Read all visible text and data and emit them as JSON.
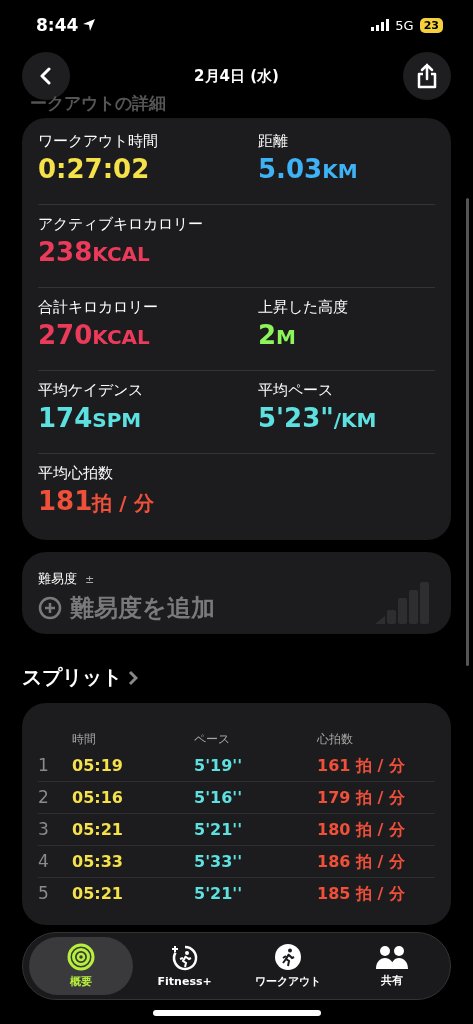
{
  "status_bar": {
    "time": "8:44",
    "network": "5G",
    "battery": "23"
  },
  "header": {
    "title": "2月4日 (水)",
    "behind_heading": "ークアウトの詳細"
  },
  "metrics": [
    {
      "cells": [
        {
          "label": "ワークアウト時間",
          "value": "0:27:02",
          "color": "#f5e14a"
        },
        {
          "label": "距離",
          "value": "5.03",
          "unit": "KM",
          "color": "#3fb1f5"
        }
      ]
    },
    {
      "cells": [
        {
          "label": "アクティブキロカロリー",
          "value": "238",
          "unit": "KCAL",
          "color": "#ec3a5a"
        }
      ]
    },
    {
      "cells": [
        {
          "label": "合計キロカロリー",
          "value": "270",
          "unit": "KCAL",
          "color": "#ec3a5a"
        },
        {
          "label": "上昇した高度",
          "value": "2",
          "unit": "M",
          "color": "#8df55a"
        }
      ]
    },
    {
      "cells": [
        {
          "label": "平均ケイデンス",
          "value": "174",
          "unit": "SPM",
          "color": "#5ce0e0"
        },
        {
          "label": "平均ペース",
          "value": "5'23\"",
          "unit": "/KM",
          "color": "#5ce0e0"
        }
      ]
    },
    {
      "cells": [
        {
          "label": "平均心拍数",
          "value": "181",
          "unit": "拍 / 分",
          "color": "#f0503a"
        }
      ]
    }
  ],
  "difficulty": {
    "label": "難易度",
    "symbol": "±",
    "action": "難易度を追加"
  },
  "splits": {
    "title": "スプリット",
    "columns": [
      "時間",
      "ペース",
      "心拍数"
    ],
    "rows": [
      {
        "index": "1",
        "time": "05:19",
        "pace": "5'19''",
        "heart": "161 拍 / 分"
      },
      {
        "index": "2",
        "time": "05:16",
        "pace": "5'16''",
        "heart": "179 拍 / 分"
      },
      {
        "index": "3",
        "time": "05:21",
        "pace": "5'21''",
        "heart": "180 拍 / 分"
      },
      {
        "index": "4",
        "time": "05:33",
        "pace": "5'33''",
        "heart": "186 拍 / 分"
      },
      {
        "index": "5",
        "time": "05:21",
        "pace": "5'21''",
        "heart": "185 拍 / 分"
      }
    ]
  },
  "tabs": [
    {
      "label": "概要",
      "kind": "rings",
      "selected": true
    },
    {
      "label": "Fitness+",
      "kind": "fitness",
      "selected": false
    },
    {
      "label": "ワークアウト",
      "kind": "workout",
      "selected": false
    },
    {
      "label": "共有",
      "kind": "sharing",
      "selected": false
    }
  ]
}
